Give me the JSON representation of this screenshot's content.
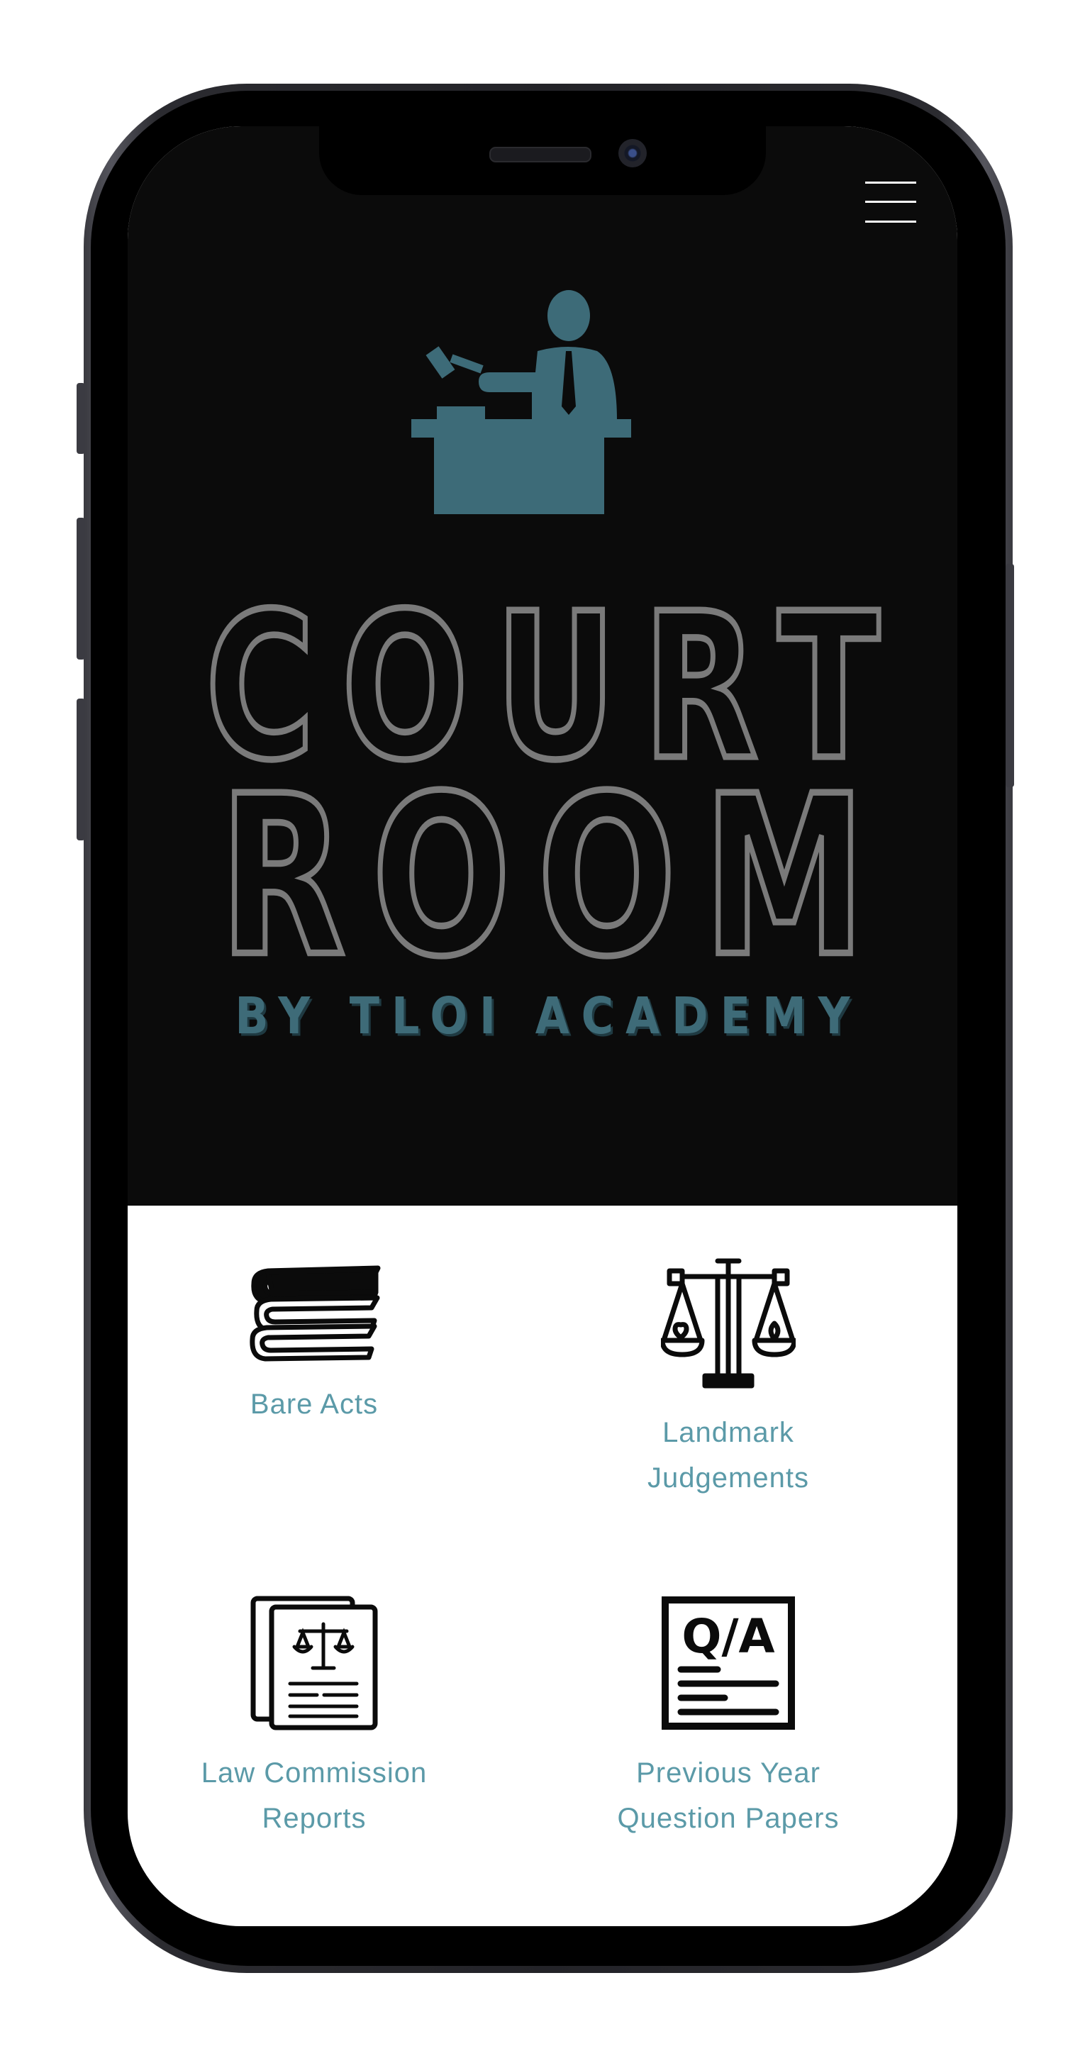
{
  "hero": {
    "logo_line1": "COURT",
    "logo_line2": "ROOM",
    "logo_tagline": "BY TLOI ACADEMY"
  },
  "cards": [
    {
      "label": "Bare Acts",
      "icon": "books-stack-icon"
    },
    {
      "label": "Landmark\nJudgements",
      "icon": "scales-of-justice-icon"
    },
    {
      "label": "Law Commission\nReports",
      "icon": "legal-document-icon"
    },
    {
      "label": "Previous Year\nQuestion Papers",
      "icon": "qa-paper-icon"
    }
  ],
  "colors": {
    "hero_background": "#0b0b0b",
    "logo_gray": "#7a7a7a",
    "logo_teal": "#3e6b78",
    "label_teal": "#5b9aa8"
  }
}
